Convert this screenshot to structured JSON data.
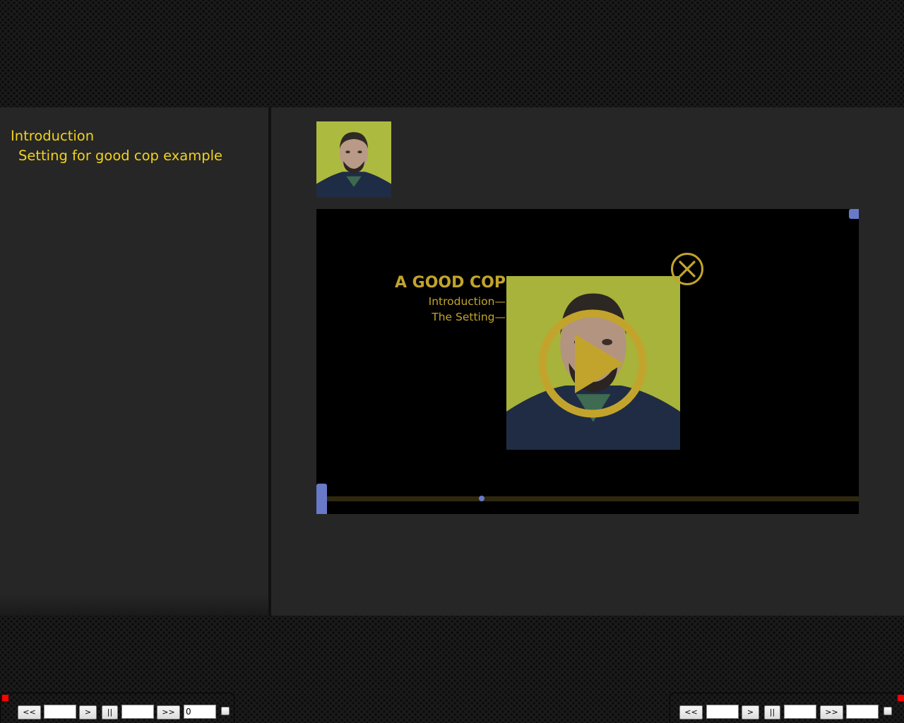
{
  "sidebar": {
    "items": [
      {
        "label": "Introduction",
        "level": 0
      },
      {
        "label": "Setting for good cop example",
        "level": 1
      }
    ]
  },
  "main": {
    "thumbnail": {
      "icon": "speaker-photo"
    },
    "player": {
      "slide": {
        "title": "A GOOD COP",
        "line1": "Introduction—",
        "line2": "The Setting—"
      },
      "video_frame": {
        "icon": "speaker-photo"
      },
      "close_icon": "close-circle-icon",
      "play_icon": "play-circle-icon",
      "accent_color": "#c2a42d",
      "handle_color": "#6979c9"
    }
  },
  "controls_left": {
    "rewind_label": "<<",
    "play_label": ">",
    "pause_label": "||",
    "forward_label": ">>",
    "field1_value": "",
    "field2_value": "",
    "counter_value": "0"
  },
  "controls_right": {
    "rewind_label": "<<",
    "play_label": ">",
    "pause_label": "||",
    "forward_label": ">>",
    "field1_value": "",
    "field2_value": "",
    "field3_value": ""
  }
}
